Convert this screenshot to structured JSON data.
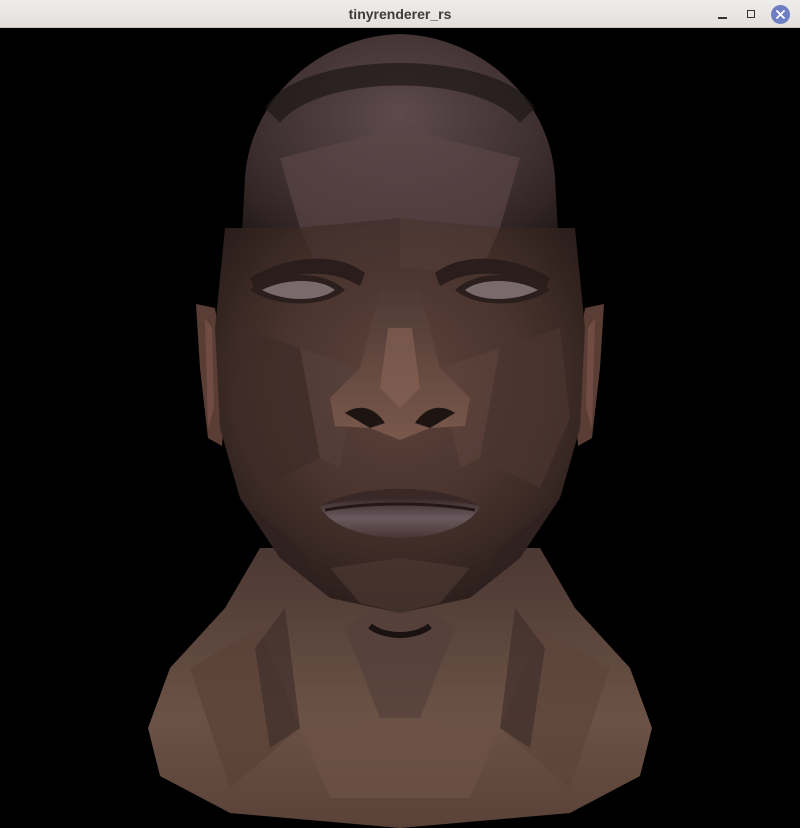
{
  "window": {
    "title": "tinyrenderer_rs",
    "buttons": {
      "minimize": "minimize-icon",
      "maximize": "maximize-icon",
      "close": "close-icon"
    },
    "colors": {
      "titlebar": "#e8e6e3",
      "close_button": "#6e7ec2",
      "canvas_background": "#000000"
    }
  },
  "canvas": {
    "content": "rendered-head-model",
    "skin_colors": [
      "#3a2a26",
      "#4a3530",
      "#5a4038",
      "#6b4e44",
      "#7a5a4e"
    ]
  }
}
